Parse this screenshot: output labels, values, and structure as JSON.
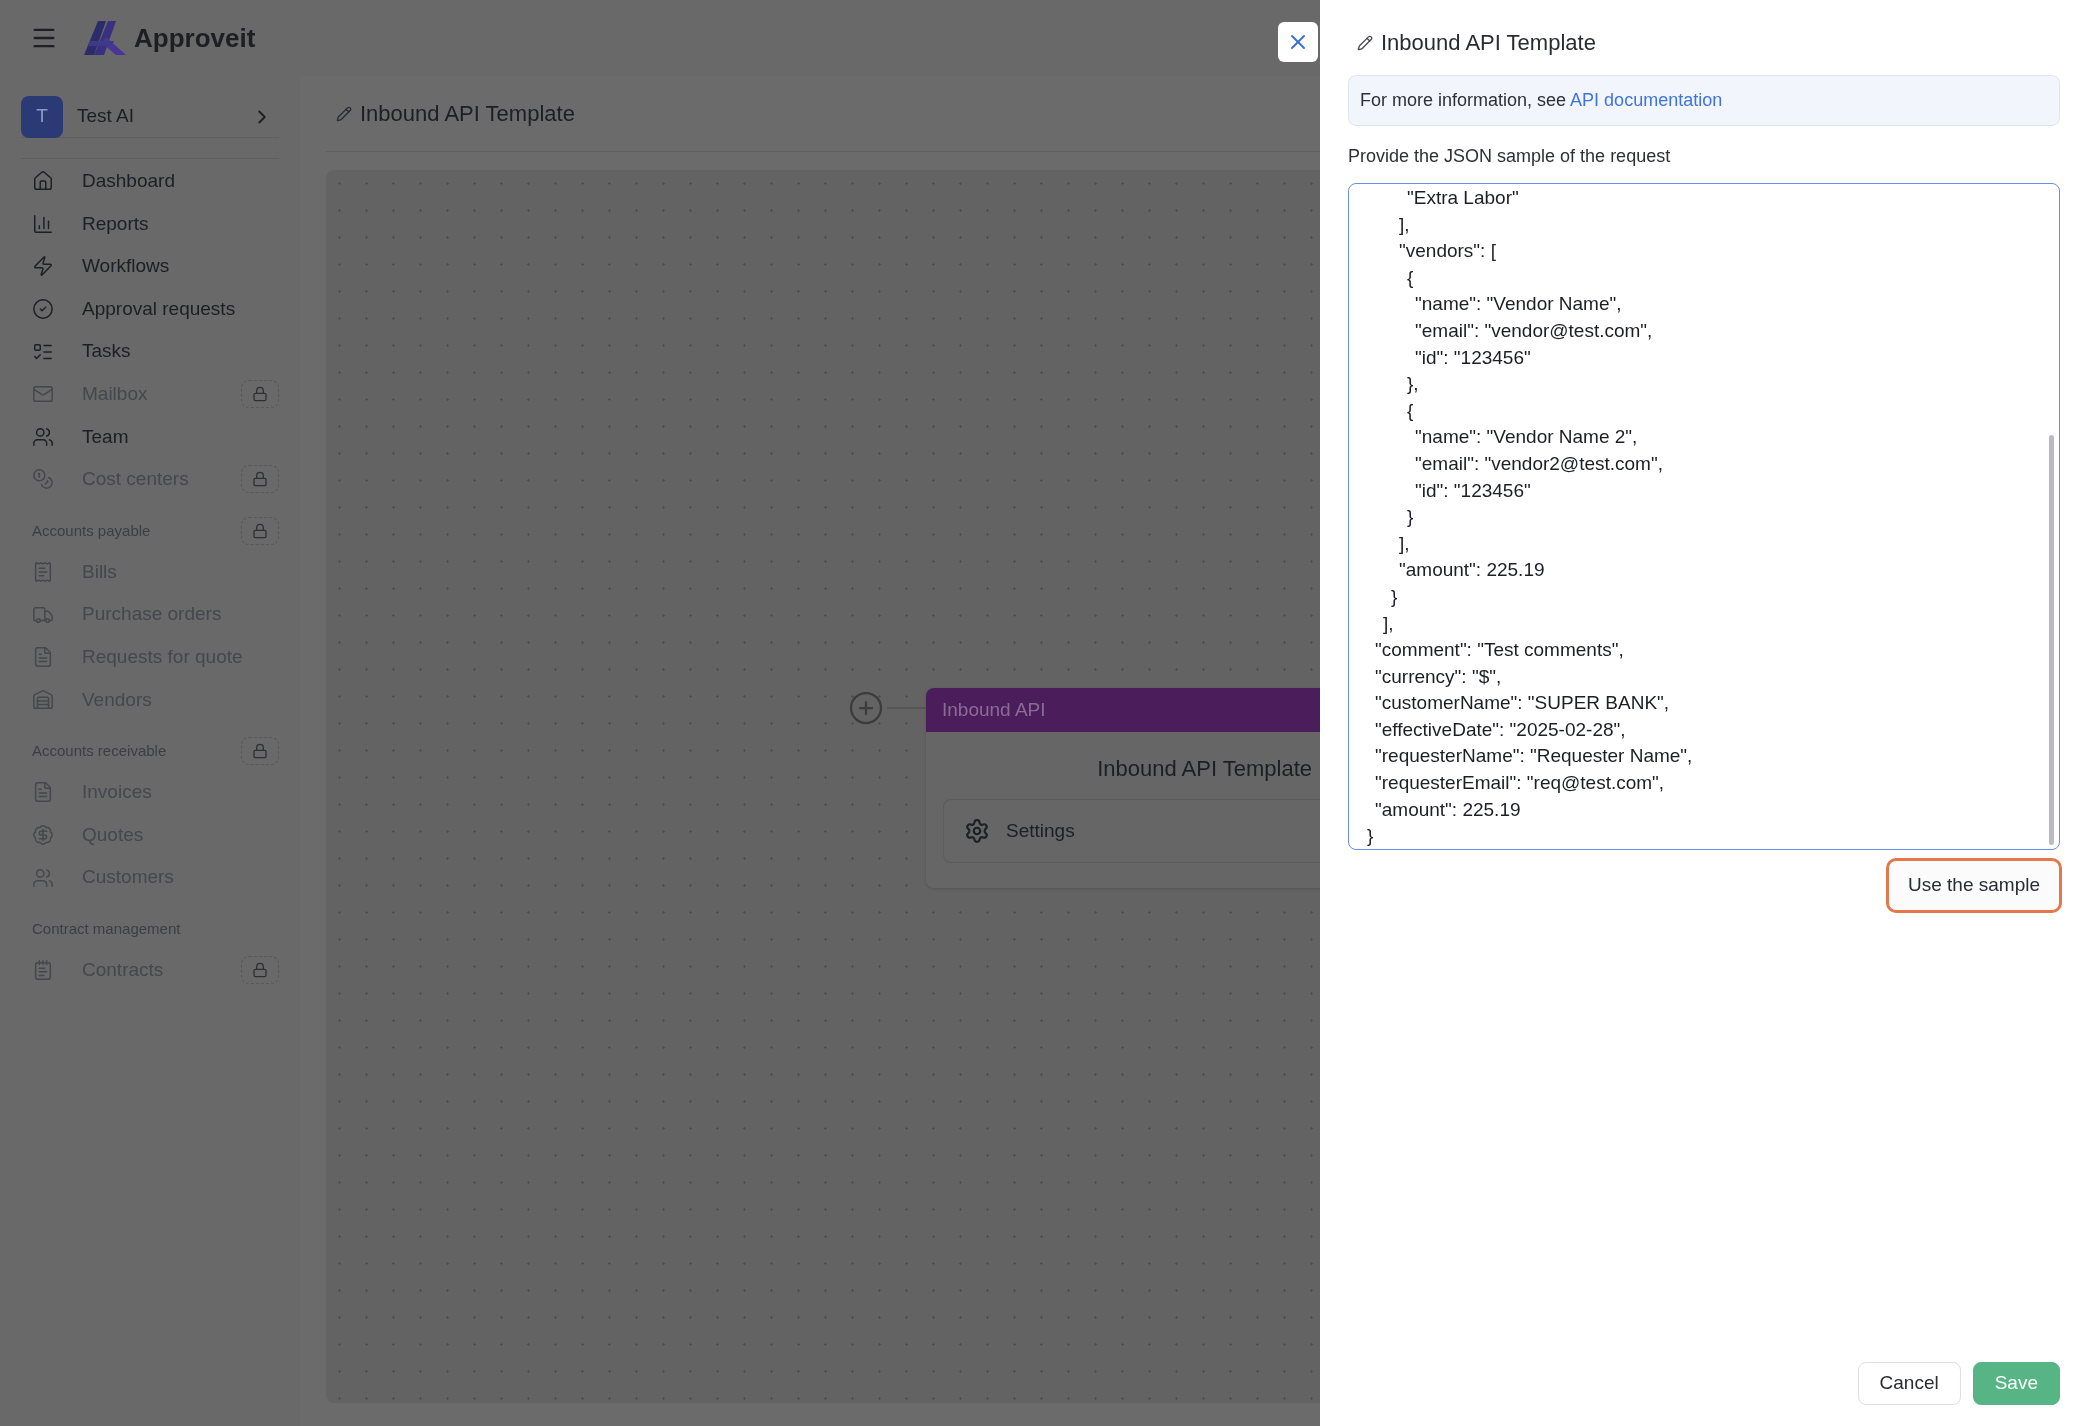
{
  "app": {
    "name": "Approveit"
  },
  "workspace": {
    "avatar": "T",
    "name": "Test AI"
  },
  "sidebar": {
    "items": [
      {
        "kind": "link",
        "label": "Dashboard",
        "disabled": false,
        "locked": false
      },
      {
        "kind": "link",
        "label": "Reports",
        "disabled": false,
        "locked": false
      },
      {
        "kind": "link",
        "label": "Workflows",
        "disabled": false,
        "locked": false
      },
      {
        "kind": "link",
        "label": "Approval requests",
        "disabled": false,
        "locked": false
      },
      {
        "kind": "link",
        "label": "Tasks",
        "disabled": false,
        "locked": false
      },
      {
        "kind": "link",
        "label": "Mailbox",
        "disabled": true,
        "locked": true
      },
      {
        "kind": "link",
        "label": "Team",
        "disabled": false,
        "locked": false
      },
      {
        "kind": "link",
        "label": "Cost centers",
        "disabled": true,
        "locked": true
      },
      {
        "kind": "heading",
        "label": "Accounts payable",
        "locked": true
      },
      {
        "kind": "link",
        "label": "Bills",
        "disabled": true,
        "locked": false
      },
      {
        "kind": "link",
        "label": "Purchase orders",
        "disabled": true,
        "locked": false
      },
      {
        "kind": "link",
        "label": "Requests for quote",
        "disabled": true,
        "locked": false
      },
      {
        "kind": "link",
        "label": "Vendors",
        "disabled": true,
        "locked": false
      },
      {
        "kind": "heading",
        "label": "Accounts receivable",
        "locked": true
      },
      {
        "kind": "link",
        "label": "Invoices",
        "disabled": true,
        "locked": false
      },
      {
        "kind": "link",
        "label": "Quotes",
        "disabled": true,
        "locked": false
      },
      {
        "kind": "link",
        "label": "Customers",
        "disabled": true,
        "locked": false
      },
      {
        "kind": "heading",
        "label": "Contract management",
        "locked": false
      },
      {
        "kind": "link",
        "label": "Contracts",
        "disabled": true,
        "locked": true
      }
    ]
  },
  "page": {
    "title": "Inbound API Template"
  },
  "canvas": {
    "node": {
      "type_label": "Inbound API",
      "title": "Inbound API Template",
      "settings_label": "Settings"
    }
  },
  "drawer": {
    "title": "Inbound API Template",
    "info_text": "For more information, see",
    "info_link": "API documentation",
    "field_label": "Provide the JSON sample of the request",
    "json_value": "\t\t\t\t\t\"Extra Labor\"\n\t\t\t\t],\n\t\t\t\t\"vendors\": [\n\t\t\t\t\t{\n\t\t\t\t\t\t\"name\": \"Vendor Name\",\n\t\t\t\t\t\t\"email\": \"vendor@test.com\",\n\t\t\t\t\t\t\"id\": \"123456\"\n\t\t\t\t\t},\n\t\t\t\t\t{\n\t\t\t\t\t\t\"name\": \"Vendor Name 2\",\n\t\t\t\t\t\t\"email\": \"vendor2@test.com\",\n\t\t\t\t\t\t\"id\": \"123456\"\n\t\t\t\t\t}\n\t\t\t\t],\n\t\t\t\t\"amount\": 225.19\n\t\t\t}\n\t\t],\n\t\"comment\": \"Test comments\",\n\t\"currency\": \"$\",\n\t\"customerName\": \"SUPER BANK\",\n\t\"effectiveDate\": \"2025-02-28\",\n\t\"requesterName\": \"Requester Name\",\n\t\"requesterEmail\": \"req@test.com\",\n\t\"amount\": 225.19\n}",
    "use_sample": {
      "label": "Use the sample",
      "focused": true
    },
    "buttons": [
      {
        "label": "Cancel",
        "kind": "secondary"
      },
      {
        "label": "Save",
        "kind": "primary"
      }
    ]
  }
}
